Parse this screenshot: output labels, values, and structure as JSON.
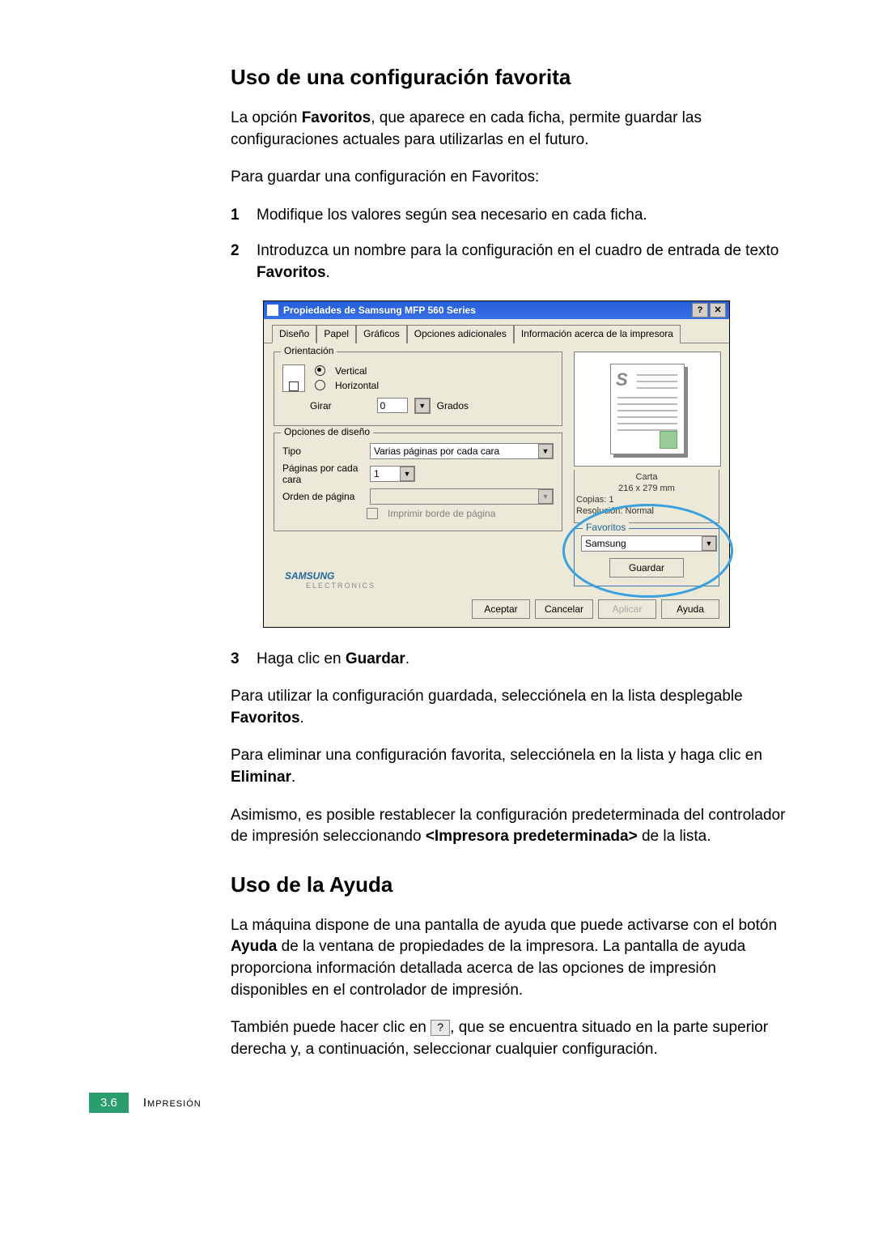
{
  "section1": {
    "title": "Uso de una configuración favorita",
    "p1a": "La opción ",
    "p1b": "Favoritos",
    "p1c": ", que aparece en cada ficha, permite guardar las configuraciones actuales para utilizarlas en el futuro.",
    "p2": "Para guardar una configuración en Favoritos:",
    "step1_num": "1",
    "step1": "Modifique los valores según sea necesario en cada ficha.",
    "step2_num": "2",
    "step2a": "Introduzca un nombre para la configuración en el cuadro de entrada de texto ",
    "step2b": "Favoritos",
    "step2c": ".",
    "step3_num": "3",
    "step3a": "Haga clic en ",
    "step3b": "Guardar",
    "step3c": ".",
    "p3a": "Para utilizar la configuración guardada, selecciónela en la lista desplegable ",
    "p3b": "Favoritos",
    "p3c": ".",
    "p4a": "Para eliminar una configuración favorita, selecciónela en la lista y haga clic en ",
    "p4b": "Eliminar",
    "p4c": ".",
    "p5a": "Asimismo, es posible restablecer la configuración predeterminada del controlador de impresión seleccionando ",
    "p5b": "<Impresora predeterminada>",
    "p5c": " de la lista."
  },
  "dialog": {
    "title": "Propiedades de Samsung MFP 560 Series",
    "help_glyph": "?",
    "close_glyph": "✕",
    "tabs": [
      "Diseño",
      "Papel",
      "Gráficos",
      "Opciones adicionales",
      "Información acerca de la impresora"
    ],
    "orientation": {
      "legend": "Orientación",
      "vertical": "Vertical",
      "horizontal": "Horizontal",
      "girar": "Girar",
      "girar_val": "0",
      "grados": "Grados"
    },
    "layout_opts": {
      "legend": "Opciones de diseño",
      "tipo": "Tipo",
      "tipo_val": "Varias páginas por cada cara",
      "ppc": "Páginas por cada cara",
      "ppc_val": "1",
      "orden": "Orden de página",
      "orden_val": "",
      "borde": "Imprimir borde de página"
    },
    "preview": {
      "carta": "Carta",
      "dim": "216 x 279 mm",
      "copias": "Copias: 1",
      "res": "Resolución: Normal"
    },
    "favoritos": {
      "legend": "Favoritos",
      "value": "Samsung",
      "guardar": "Guardar"
    },
    "brand": "SAMSUNG",
    "brand_sub": "ELECTRONICS",
    "buttons": {
      "aceptar": "Aceptar",
      "cancelar": "Cancelar",
      "aplicar": "Aplicar",
      "ayuda": "Ayuda"
    }
  },
  "section2": {
    "title": "Uso de la Ayuda",
    "p1a": "La máquina dispone de una pantalla de ayuda que puede activarse con el botón ",
    "p1b": "Ayuda",
    "p1c": " de la ventana de propiedades de la impresora. La pantalla de ayuda proporciona información detallada acerca de las opciones de impresión disponibles en el controlador de impresión.",
    "p2a": "También puede hacer clic en ",
    "help_glyph": "?",
    "p2b": ", que se encuentra situado en la parte superior derecha y, a continuación, seleccionar cualquier configuración."
  },
  "footer": {
    "page": "3.6",
    "label": "Impresión"
  }
}
